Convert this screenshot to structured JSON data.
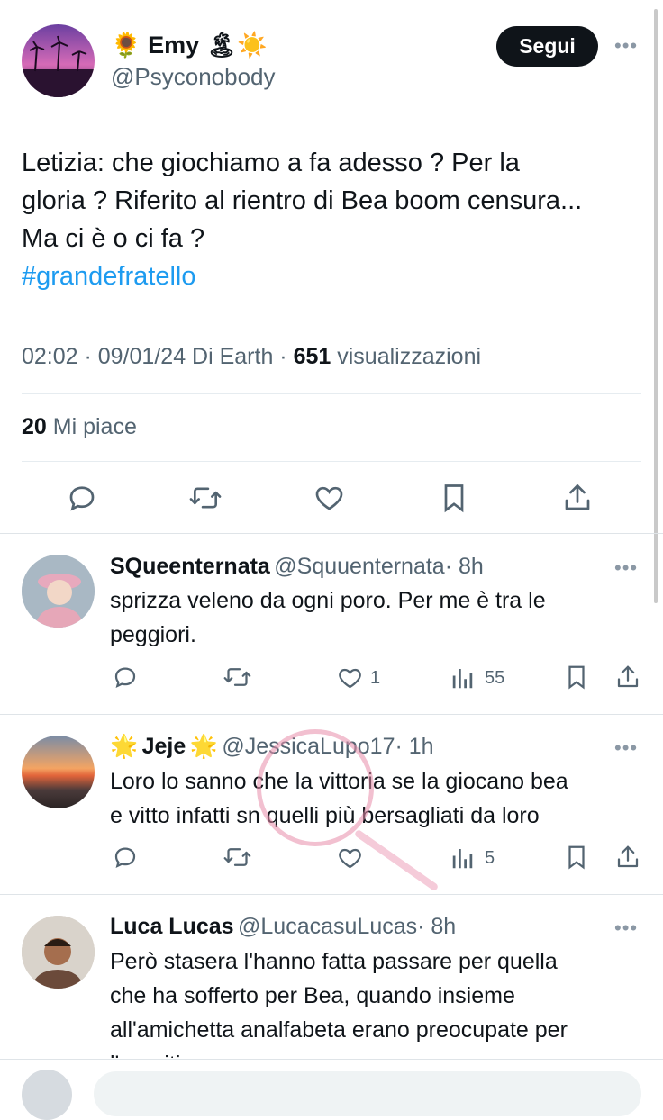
{
  "tweet": {
    "name_prefix_emoji": "🌻",
    "name": "Emy",
    "name_suffix_emoji": "🏝☀️",
    "handle": "@Psyconobody",
    "follow_label": "Segui",
    "text_line1": "Letizia: che giochiamo a fa adesso ? Per la",
    "text_line2": "gloria ?  Riferito al rientro di Bea boom censura...",
    "text_line3": "Ma ci è o ci fa ?",
    "hashtag": "#grandefratello",
    "meta_time": "02:02 · 09/01/24 Di Earth ·",
    "views_count": "651",
    "views_label": "visualizzazioni",
    "likes_count": "20",
    "likes_label": "Mi piace",
    "actions": [
      "reply-icon",
      "retweet-icon",
      "like-icon",
      "bookmark-icon",
      "share-icon"
    ]
  },
  "replies": [
    {
      "name": "SQueenternata",
      "handle": "@Squuenternata",
      "time": "· 8h",
      "line1": "sprizza veleno da ogni poro. Per me è tra le",
      "line2": "peggiori.",
      "likes": "1",
      "views": "55"
    },
    {
      "name_prefix_emoji": "🌟",
      "name": "Jeje",
      "name_suffix_emoji": "🌟",
      "handle": "@JessicaLupo17",
      "time": "· 1h",
      "line1": "Loro lo sanno che la vittoria se la giocano bea",
      "line2": "e vitto infatti sn quelli più bersagliati da loro",
      "likes": "",
      "views": "5"
    },
    {
      "name": "Luca Lucas",
      "handle": "@LucacasuLucas",
      "time": "· 8h",
      "line1": "Però stasera l'hanno fatta passare per quella",
      "line2": "che ha sofferto per Bea, quando insieme",
      "line3": "all'amichetta analfabeta erano preocupate per",
      "line4": "l'aperitivo"
    }
  ],
  "colors": {
    "accent": "#1d9bf0",
    "text": "#0f1419",
    "muted": "#536471"
  }
}
